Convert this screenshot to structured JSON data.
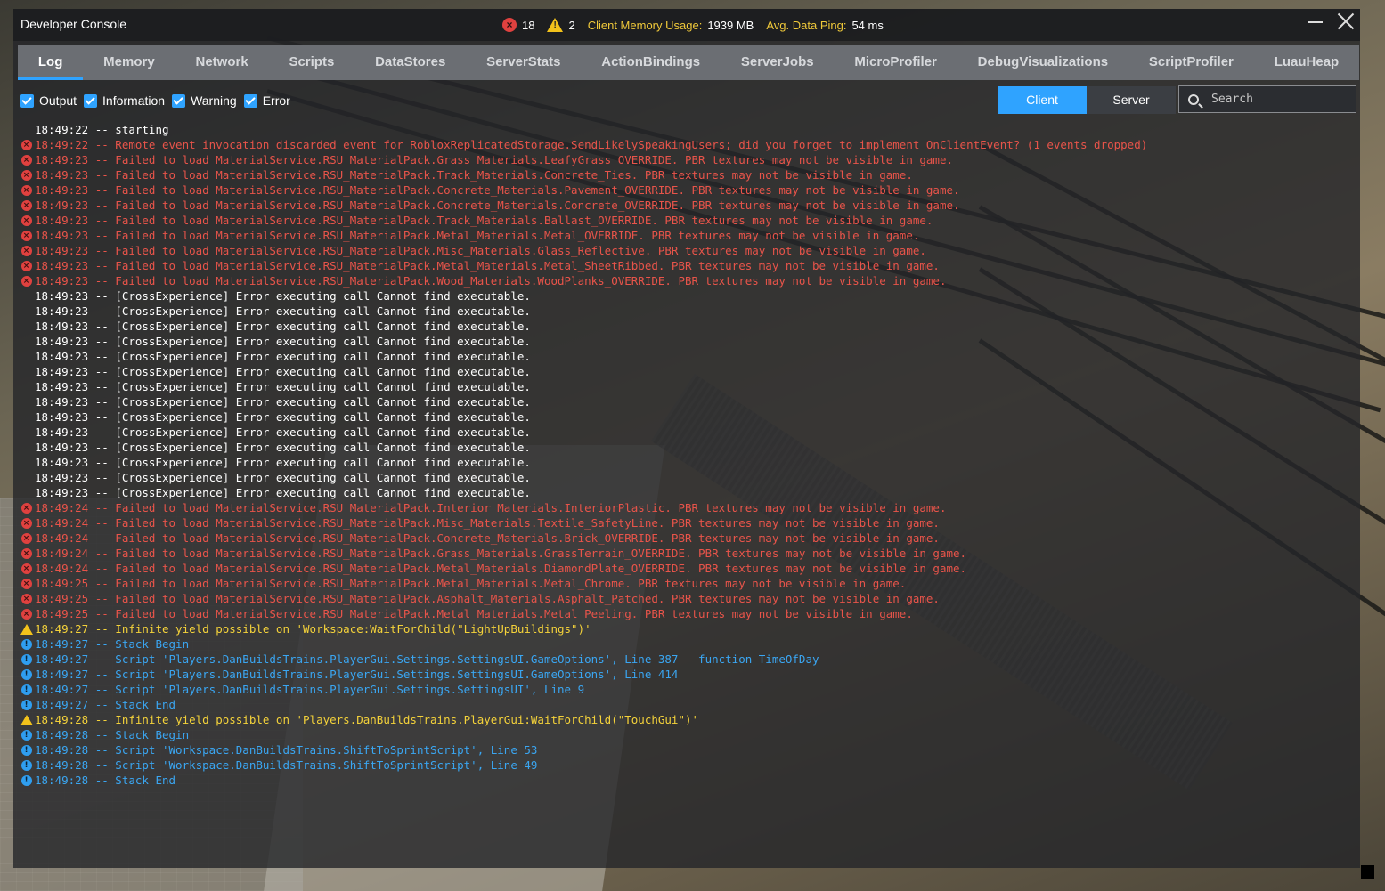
{
  "window": {
    "title": "Developer Console",
    "error_count": "18",
    "warning_count": "2",
    "memory_label": "Client Memory Usage:",
    "memory_value": "1939 MB",
    "ping_label": "Avg. Data Ping:",
    "ping_value": "54 ms"
  },
  "tabs": [
    {
      "label": "Log"
    },
    {
      "label": "Memory"
    },
    {
      "label": "Network"
    },
    {
      "label": "Scripts"
    },
    {
      "label": "DataStores"
    },
    {
      "label": "ServerStats"
    },
    {
      "label": "ActionBindings"
    },
    {
      "label": "ServerJobs"
    },
    {
      "label": "MicroProfiler"
    },
    {
      "label": "DebugVisualizations"
    },
    {
      "label": "ScriptProfiler"
    },
    {
      "label": "LuauHeap"
    }
  ],
  "filters": [
    {
      "label": "Output"
    },
    {
      "label": "Information"
    },
    {
      "label": "Warning"
    },
    {
      "label": "Error"
    }
  ],
  "scope": {
    "client_label": "Client",
    "server_label": "Server"
  },
  "search": {
    "placeholder": "Search"
  },
  "log": [
    {
      "type": "output",
      "text": "18:49:22 -- starting"
    },
    {
      "type": "error",
      "text": "18:49:22 -- Remote event invocation discarded event for RobloxReplicatedStorage.SendLikelySpeakingUsers; did you forget to implement OnClientEvent? (1 events dropped)"
    },
    {
      "type": "error",
      "text": "18:49:23 -- Failed to load MaterialService.RSU_MaterialPack.Grass_Materials.LeafyGrass_OVERRIDE. PBR textures may not be visible in game."
    },
    {
      "type": "error",
      "text": "18:49:23 -- Failed to load MaterialService.RSU_MaterialPack.Track_Materials.Concrete_Ties. PBR textures may not be visible in game."
    },
    {
      "type": "error",
      "text": "18:49:23 -- Failed to load MaterialService.RSU_MaterialPack.Concrete_Materials.Pavement_OVERRIDE. PBR textures may not be visible in game."
    },
    {
      "type": "error",
      "text": "18:49:23 -- Failed to load MaterialService.RSU_MaterialPack.Concrete_Materials.Concrete_OVERRIDE. PBR textures may not be visible in game."
    },
    {
      "type": "error",
      "text": "18:49:23 -- Failed to load MaterialService.RSU_MaterialPack.Track_Materials.Ballast_OVERRIDE. PBR textures may not be visible in game."
    },
    {
      "type": "error",
      "text": "18:49:23 -- Failed to load MaterialService.RSU_MaterialPack.Metal_Materials.Metal_OVERRIDE. PBR textures may not be visible in game."
    },
    {
      "type": "error",
      "text": "18:49:23 -- Failed to load MaterialService.RSU_MaterialPack.Misc_Materials.Glass_Reflective. PBR textures may not be visible in game."
    },
    {
      "type": "error",
      "text": "18:49:23 -- Failed to load MaterialService.RSU_MaterialPack.Metal_Materials.Metal_SheetRibbed. PBR textures may not be visible in game."
    },
    {
      "type": "error",
      "text": "18:49:23 -- Failed to load MaterialService.RSU_MaterialPack.Wood_Materials.WoodPlanks_OVERRIDE. PBR textures may not be visible in game."
    },
    {
      "type": "output",
      "text": "18:49:23 -- [CrossExperience] Error executing call Cannot find executable."
    },
    {
      "type": "output",
      "text": "18:49:23 -- [CrossExperience] Error executing call Cannot find executable."
    },
    {
      "type": "output",
      "text": "18:49:23 -- [CrossExperience] Error executing call Cannot find executable."
    },
    {
      "type": "output",
      "text": "18:49:23 -- [CrossExperience] Error executing call Cannot find executable."
    },
    {
      "type": "output",
      "text": "18:49:23 -- [CrossExperience] Error executing call Cannot find executable."
    },
    {
      "type": "output",
      "text": "18:49:23 -- [CrossExperience] Error executing call Cannot find executable."
    },
    {
      "type": "output",
      "text": "18:49:23 -- [CrossExperience] Error executing call Cannot find executable."
    },
    {
      "type": "output",
      "text": "18:49:23 -- [CrossExperience] Error executing call Cannot find executable."
    },
    {
      "type": "output",
      "text": "18:49:23 -- [CrossExperience] Error executing call Cannot find executable."
    },
    {
      "type": "output",
      "text": "18:49:23 -- [CrossExperience] Error executing call Cannot find executable."
    },
    {
      "type": "output",
      "text": "18:49:23 -- [CrossExperience] Error executing call Cannot find executable."
    },
    {
      "type": "output",
      "text": "18:49:23 -- [CrossExperience] Error executing call Cannot find executable."
    },
    {
      "type": "output",
      "text": "18:49:23 -- [CrossExperience] Error executing call Cannot find executable."
    },
    {
      "type": "output",
      "text": "18:49:23 -- [CrossExperience] Error executing call Cannot find executable."
    },
    {
      "type": "error",
      "text": "18:49:24 -- Failed to load MaterialService.RSU_MaterialPack.Interior_Materials.InteriorPlastic. PBR textures may not be visible in game."
    },
    {
      "type": "error",
      "text": "18:49:24 -- Failed to load MaterialService.RSU_MaterialPack.Misc_Materials.Textile_SafetyLine. PBR textures may not be visible in game."
    },
    {
      "type": "error",
      "text": "18:49:24 -- Failed to load MaterialService.RSU_MaterialPack.Concrete_Materials.Brick_OVERRIDE. PBR textures may not be visible in game."
    },
    {
      "type": "error",
      "text": "18:49:24 -- Failed to load MaterialService.RSU_MaterialPack.Grass_Materials.GrassTerrain_OVERRIDE. PBR textures may not be visible in game."
    },
    {
      "type": "error",
      "text": "18:49:24 -- Failed to load MaterialService.RSU_MaterialPack.Metal_Materials.DiamondPlate_OVERRIDE. PBR textures may not be visible in game."
    },
    {
      "type": "error",
      "text": "18:49:25 -- Failed to load MaterialService.RSU_MaterialPack.Metal_Materials.Metal_Chrome. PBR textures may not be visible in game."
    },
    {
      "type": "error",
      "text": "18:49:25 -- Failed to load MaterialService.RSU_MaterialPack.Asphalt_Materials.Asphalt_Patched. PBR textures may not be visible in game."
    },
    {
      "type": "error",
      "text": "18:49:25 -- Failed to load MaterialService.RSU_MaterialPack.Metal_Materials.Metal_Peeling. PBR textures may not be visible in game."
    },
    {
      "type": "warning",
      "text": "18:49:27 -- Infinite yield possible on 'Workspace:WaitForChild(\"LightUpBuildings\")'"
    },
    {
      "type": "info",
      "text": "18:49:27 -- Stack Begin"
    },
    {
      "type": "info",
      "text": "18:49:27 -- Script 'Players.DanBuildsTrains.PlayerGui.Settings.SettingsUI.GameOptions', Line 387 - function TimeOfDay"
    },
    {
      "type": "info",
      "text": "18:49:27 -- Script 'Players.DanBuildsTrains.PlayerGui.Settings.SettingsUI.GameOptions', Line 414"
    },
    {
      "type": "info",
      "text": "18:49:27 -- Script 'Players.DanBuildsTrains.PlayerGui.Settings.SettingsUI', Line 9"
    },
    {
      "type": "info",
      "text": "18:49:27 -- Stack End"
    },
    {
      "type": "warning",
      "text": "18:49:28 -- Infinite yield possible on 'Players.DanBuildsTrains.PlayerGui:WaitForChild(\"TouchGui\")'"
    },
    {
      "type": "info",
      "text": "18:49:28 -- Stack Begin"
    },
    {
      "type": "info",
      "text": "18:49:28 -- Script 'Workspace.DanBuildsTrains.ShiftToSprintScript', Line 53"
    },
    {
      "type": "info",
      "text": "18:49:28 -- Script 'Workspace.DanBuildsTrains.ShiftToSprintScript', Line 49"
    },
    {
      "type": "info",
      "text": "18:49:28 -- Stack End"
    }
  ]
}
